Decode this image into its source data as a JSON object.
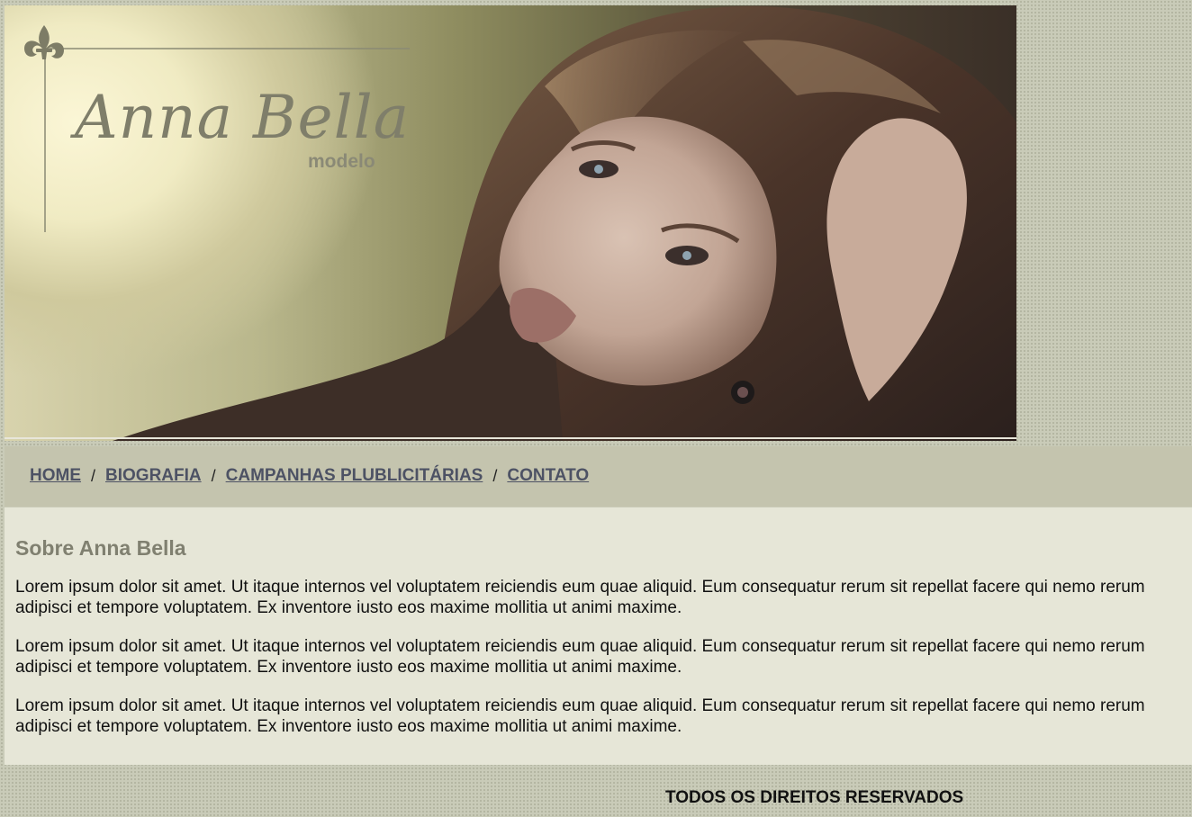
{
  "header": {
    "logo_name": "Anna Bella",
    "logo_subtitle": "modelo",
    "hero_image": "model-portrait-photo"
  },
  "nav": {
    "items": [
      {
        "label": "HOME"
      },
      {
        "label": "BIOGRAFIA"
      },
      {
        "label": "CAMPANHAS PLUBLICITÁRIAS"
      },
      {
        "label": "CONTATO"
      }
    ],
    "separator": "/"
  },
  "main": {
    "title": "Sobre Anna Bella",
    "paragraphs": [
      {
        "line1": "Lorem ipsum dolor sit amet. Ut itaque internos vel voluptatem reiciendis eum quae aliquid. Eum consequatur rerum sit repellat facere qui nemo rerum",
        "line2": "adipisci et tempore voluptatem. Ex inventore iusto eos maxime mollitia ut animi maxime."
      },
      {
        "line1": "Lorem ipsum dolor sit amet. Ut itaque internos vel voluptatem reiciendis eum quae aliquid. Eum consequatur rerum sit repellat facere qui nemo rerum",
        "line2": "adipisci et tempore voluptatem. Ex inventore iusto eos maxime mollitia ut animi maxime."
      },
      {
        "line1": "Lorem ipsum dolor sit amet. Ut itaque internos vel voluptatem reiciendis eum quae aliquid. Eum consequatur rerum sit repellat facere qui nemo rerum",
        "line2": "adipisci et tempore voluptatem. Ex inventore iusto eos maxime mollitia ut animi maxime."
      }
    ]
  },
  "footer": {
    "text": "TODOS OS DIREITOS RESERVADOS"
  },
  "colors": {
    "page_bg": "#c9cbb8",
    "nav_bg": "#c4c4ae",
    "nav_link": "#4d5264",
    "content_bg": "#e6e6d7",
    "title": "#808070",
    "logo": "#7f7e6a"
  }
}
